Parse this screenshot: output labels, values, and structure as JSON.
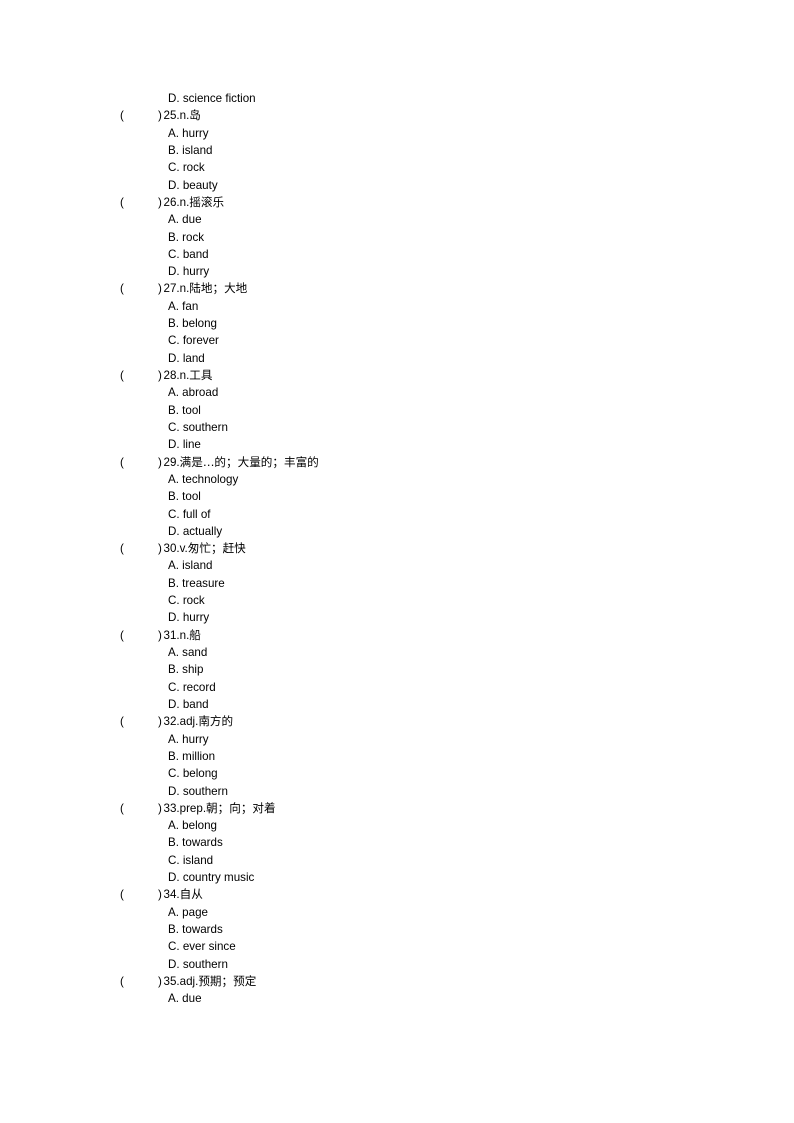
{
  "document": {
    "type": "vocabulary-multiple-choice-worksheet",
    "page_background": "#ffffff",
    "text_color": "#000000",
    "orphan_option_top": {
      "label": "D.",
      "text": "science fiction",
      "full": "D. science fiction"
    },
    "questions": [
      {
        "open_paren": "(",
        "close_paren": ")",
        "number": "25.",
        "pos": "n.",
        "chinese": "岛",
        "stem": ")25.n.岛",
        "options": [
          {
            "full": "A. hurry"
          },
          {
            "full": "B. island"
          },
          {
            "full": "C. rock"
          },
          {
            "full": "D. beauty"
          }
        ]
      },
      {
        "open_paren": "(",
        "close_paren": ")",
        "number": "26.",
        "pos": "n.",
        "chinese": "摇滚乐",
        "stem": ")26.n.摇滚乐",
        "options": [
          {
            "full": "A. due"
          },
          {
            "full": "B. rock"
          },
          {
            "full": "C. band"
          },
          {
            "full": "D. hurry"
          }
        ]
      },
      {
        "open_paren": "(",
        "close_paren": ")",
        "number": "27.",
        "pos": "n.",
        "chinese": "陆地；大地",
        "stem": ")27.n.陆地；大地",
        "options": [
          {
            "full": "A. fan"
          },
          {
            "full": "B. belong"
          },
          {
            "full": "C. forever"
          },
          {
            "full": "D. land"
          }
        ]
      },
      {
        "open_paren": "(",
        "close_paren": ")",
        "number": "28.",
        "pos": "n.",
        "chinese": "工具",
        "stem": ")28.n.工具",
        "options": [
          {
            "full": "A. abroad"
          },
          {
            "full": "B. tool"
          },
          {
            "full": "C. southern"
          },
          {
            "full": "D. line"
          }
        ]
      },
      {
        "open_paren": "(",
        "close_paren": ")",
        "number": "29.",
        "pos": "",
        "chinese": "满是…的；大量的；丰富的",
        "stem": ")29.满是…的；大量的；丰富的",
        "options": [
          {
            "full": "A. technology"
          },
          {
            "full": "B. tool"
          },
          {
            "full": "C. full of"
          },
          {
            "full": "D. actually"
          }
        ]
      },
      {
        "open_paren": "(",
        "close_paren": ")",
        "number": "30.",
        "pos": "v.",
        "chinese": "匆忙；赶快",
        "stem": ")30.v.匆忙；赶快",
        "options": [
          {
            "full": "A. island"
          },
          {
            "full": "B. treasure"
          },
          {
            "full": "C. rock"
          },
          {
            "full": "D. hurry"
          }
        ]
      },
      {
        "open_paren": "(",
        "close_paren": ")",
        "number": "31.",
        "pos": "n.",
        "chinese": "船",
        "stem": ")31.n.船",
        "options": [
          {
            "full": "A. sand"
          },
          {
            "full": "B. ship"
          },
          {
            "full": "C. record"
          },
          {
            "full": "D. band"
          }
        ]
      },
      {
        "open_paren": "(",
        "close_paren": ")",
        "number": "32.",
        "pos": "adj.",
        "chinese": "南方的",
        "stem": ")32.adj.南方的",
        "options": [
          {
            "full": "A. hurry"
          },
          {
            "full": "B. million"
          },
          {
            "full": "C. belong"
          },
          {
            "full": "D. southern"
          }
        ]
      },
      {
        "open_paren": "(",
        "close_paren": ")",
        "number": "33.",
        "pos": "prep.",
        "chinese": "朝；向；对着",
        "stem": ")33.prep.朝；向；对着",
        "options": [
          {
            "full": "A. belong"
          },
          {
            "full": "B. towards"
          },
          {
            "full": "C. island"
          },
          {
            "full": "D. country music"
          }
        ]
      },
      {
        "open_paren": "(",
        "close_paren": ")",
        "number": "34.",
        "pos": "",
        "chinese": "自从",
        "stem": ")34.自从",
        "options": [
          {
            "full": "A. page"
          },
          {
            "full": "B. towards"
          },
          {
            "full": "C. ever since"
          },
          {
            "full": "D. southern"
          }
        ]
      },
      {
        "open_paren": "(",
        "close_paren": ")",
        "number": "35.",
        "pos": "adj.",
        "chinese": "预期；预定",
        "stem": ")35.adj.预期；预定",
        "options": [
          {
            "full": "A. due"
          }
        ]
      }
    ]
  }
}
